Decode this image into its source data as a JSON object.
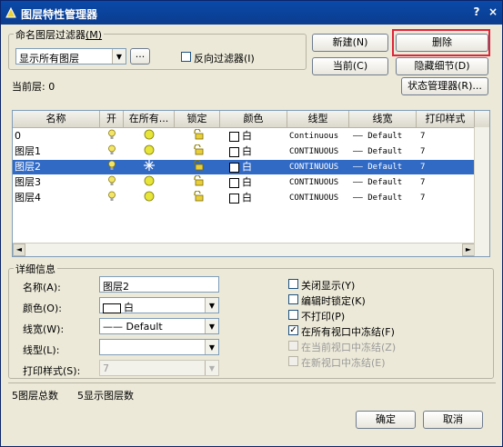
{
  "window": {
    "title": "图层特性管理器",
    "help_label": "?",
    "close_label": "×"
  },
  "filter": {
    "group_label": "命名图层过滤器",
    "group_key": "(M)",
    "selected": "显示所有图层",
    "browse_label": "...",
    "invert_label": "反向过滤器",
    "invert_key": "(I)"
  },
  "buttons": {
    "new": {
      "label": "新建",
      "key": "(N)"
    },
    "delete": {
      "label": "删除",
      "key": ""
    },
    "current": {
      "label": "当前",
      "key": "(C)"
    },
    "hide_details": {
      "label": "隐藏细节",
      "key": "(D)"
    },
    "state_manager": {
      "label": "状态管理器",
      "key": "(R)..."
    },
    "ok": {
      "label": "确定"
    },
    "cancel": {
      "label": "取消"
    }
  },
  "current_layer": {
    "label": "当前层:",
    "value": "0"
  },
  "table": {
    "columns": [
      "名称",
      "开",
      "在所有...",
      "锁定",
      "颜色",
      "线型",
      "线宽",
      "打印样式"
    ],
    "rows": [
      {
        "name": "0",
        "color": "白",
        "linetype": "Continuous",
        "lineweight": "Default",
        "plot": "7",
        "selected": false
      },
      {
        "name": "图层1",
        "color": "白",
        "linetype": "CONTINUOUS",
        "lineweight": "Default",
        "plot": "7",
        "selected": false
      },
      {
        "name": "图层2",
        "color": "白",
        "linetype": "CONTINUOUS",
        "lineweight": "Default",
        "plot": "7",
        "selected": true
      },
      {
        "name": "图层3",
        "color": "白",
        "linetype": "CONTINUOUS",
        "lineweight": "Default",
        "plot": "7",
        "selected": false
      },
      {
        "name": "图层4",
        "color": "白",
        "linetype": "CONTINUOUS",
        "lineweight": "Default",
        "plot": "7",
        "selected": false
      }
    ],
    "lineweight_dash": "——"
  },
  "details": {
    "group_label": "详细信息",
    "name_label": "名称(A):",
    "name_value": "图层2",
    "color_label": "颜色(O):",
    "color_value": "白",
    "lineweight_label": "线宽(W):",
    "lineweight_value": "Default",
    "lineweight_dash": "——",
    "linetype_label": "线型(L):",
    "linetype_value": "",
    "plotstyle_label": "打印样式(S):",
    "plotstyle_value": "7",
    "options": [
      {
        "label": "关闭显示(Y)",
        "checked": false,
        "disabled": false
      },
      {
        "label": "编辑时锁定(K)",
        "checked": false,
        "disabled": false
      },
      {
        "label": "不打印(P)",
        "checked": false,
        "disabled": false
      },
      {
        "label": "在所有视口中冻结(F)",
        "checked": true,
        "disabled": false
      },
      {
        "label": "在当前视口中冻结(Z)",
        "checked": false,
        "disabled": true
      },
      {
        "label": "在新视口中冻结(E)",
        "checked": false,
        "disabled": true
      }
    ]
  },
  "status": {
    "total": "5图层总数",
    "shown": "5显示图层数"
  },
  "colors": {
    "titlebar": "#0b3c8f",
    "selection": "#316ac5",
    "highlight_box": "#e0243a",
    "bulb_on": "#f3e56a",
    "frozen_sun": "#e7e43a"
  }
}
